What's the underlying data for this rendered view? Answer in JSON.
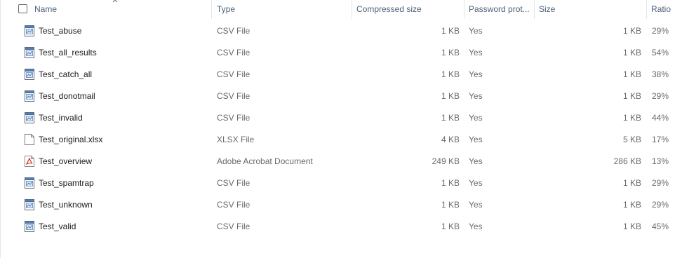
{
  "columns": {
    "name": "Name",
    "type": "Type",
    "compressed_size": "Compressed size",
    "password_protected": "Password prot...",
    "size": "Size",
    "ratio": "Ratio"
  },
  "files": [
    {
      "name": "Test_abuse",
      "type": "CSV File",
      "compressed_size": "1 KB",
      "password_protected": "Yes",
      "size": "1 KB",
      "ratio": "29%",
      "icon": "csv-file-icon"
    },
    {
      "name": "Test_all_results",
      "type": "CSV File",
      "compressed_size": "1 KB",
      "password_protected": "Yes",
      "size": "1 KB",
      "ratio": "54%",
      "icon": "csv-file-icon"
    },
    {
      "name": "Test_catch_all",
      "type": "CSV File",
      "compressed_size": "1 KB",
      "password_protected": "Yes",
      "size": "1 KB",
      "ratio": "38%",
      "icon": "csv-file-icon"
    },
    {
      "name": "Test_donotmail",
      "type": "CSV File",
      "compressed_size": "1 KB",
      "password_protected": "Yes",
      "size": "1 KB",
      "ratio": "29%",
      "icon": "csv-file-icon"
    },
    {
      "name": "Test_invalid",
      "type": "CSV File",
      "compressed_size": "1 KB",
      "password_protected": "Yes",
      "size": "1 KB",
      "ratio": "44%",
      "icon": "csv-file-icon"
    },
    {
      "name": "Test_original.xlsx",
      "type": "XLSX File",
      "compressed_size": "4 KB",
      "password_protected": "Yes",
      "size": "5 KB",
      "ratio": "17%",
      "icon": "blank-file-icon"
    },
    {
      "name": "Test_overview",
      "type": "Adobe Acrobat Document",
      "compressed_size": "249 KB",
      "password_protected": "Yes",
      "size": "286 KB",
      "ratio": "13%",
      "icon": "pdf-file-icon"
    },
    {
      "name": "Test_spamtrap",
      "type": "CSV File",
      "compressed_size": "1 KB",
      "password_protected": "Yes",
      "size": "1 KB",
      "ratio": "29%",
      "icon": "csv-file-icon"
    },
    {
      "name": "Test_unknown",
      "type": "CSV File",
      "compressed_size": "1 KB",
      "password_protected": "Yes",
      "size": "1 KB",
      "ratio": "29%",
      "icon": "csv-file-icon"
    },
    {
      "name": "Test_valid",
      "type": "CSV File",
      "compressed_size": "1 KB",
      "password_protected": "Yes",
      "size": "1 KB",
      "ratio": "45%",
      "icon": "csv-file-icon"
    }
  ],
  "colors": {
    "header_text": "#4c607a",
    "secondary_text": "#6a6a6a",
    "divider": "#e5e5e5",
    "pdf_red": "#d9342b",
    "csv_blue": "#4a7fc1"
  }
}
